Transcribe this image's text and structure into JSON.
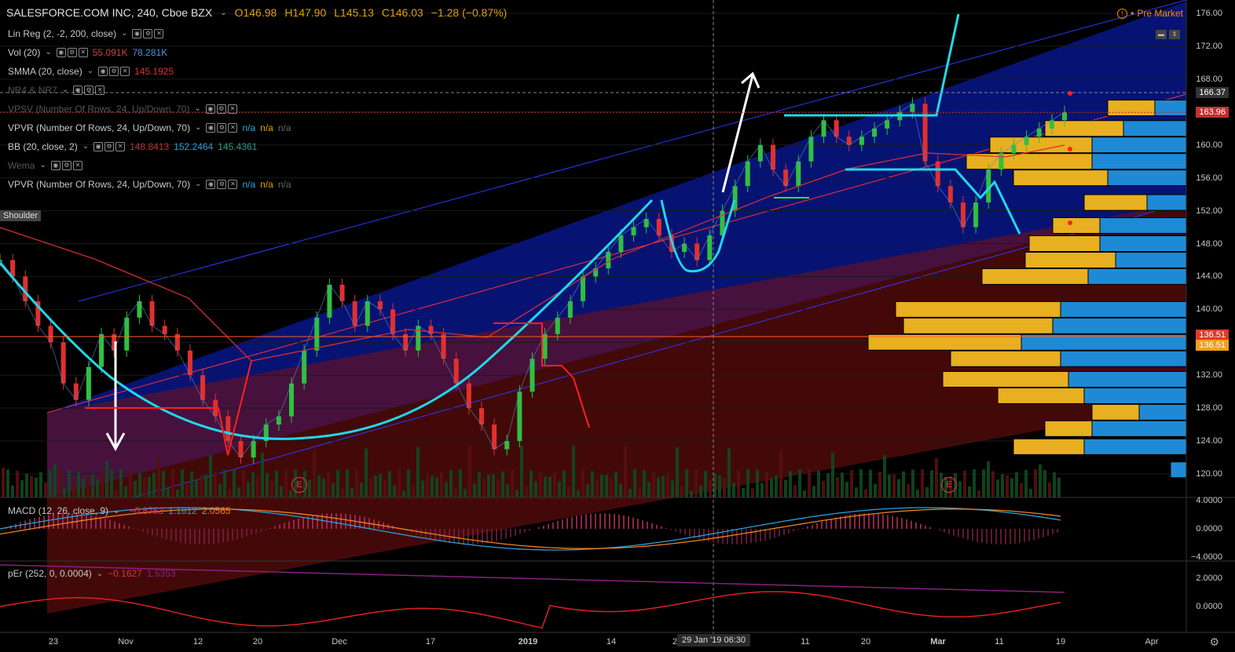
{
  "header": {
    "symbol": "SALESFORCE.COM INC, 240, Cboe BZX",
    "open": "O146.98",
    "high": "H147.90",
    "low": "L145.13",
    "close": "C146.03",
    "change": "−1.28 (−0.87%)",
    "pre_market": "Pre Market"
  },
  "indicators": [
    {
      "name": "Lin Reg (2, -2, 200, close)",
      "values": []
    },
    {
      "name": "Vol (20)",
      "values": [
        {
          "text": "55.091K",
          "color": "#d04040"
        },
        {
          "text": "78.281K",
          "color": "#4a90e2"
        }
      ]
    },
    {
      "name": "SMMA (20, close)",
      "values": [
        {
          "text": "145.1925",
          "color": "#e03030"
        }
      ]
    },
    {
      "name": "NR4 & NR7",
      "values": [],
      "dim": true
    },
    {
      "name": "VPSV (Number Of Rows, 24, Up/Down, 70)",
      "values": [],
      "dim": true
    },
    {
      "name": "VPVR (Number Of Rows, 24, Up/Down, 70)",
      "values": [
        {
          "text": "n/a",
          "color": "#29a8e0"
        },
        {
          "text": "n/a",
          "color": "#e0a000"
        },
        {
          "text": "n/a",
          "color": "#666"
        }
      ]
    },
    {
      "name": "BB (20, close, 2)",
      "values": [
        {
          "text": "148.8413",
          "color": "#c03030"
        },
        {
          "text": "152.2464",
          "color": "#2a9fd6"
        },
        {
          "text": "145.4361",
          "color": "#2a9f8a"
        }
      ]
    },
    {
      "name": "Wema",
      "values": [],
      "dim": true
    },
    {
      "name": "VPVR (Number Of Rows, 24, Up/Down, 70)",
      "values": [
        {
          "text": "n/a",
          "color": "#29a8e0"
        },
        {
          "text": "n/a",
          "color": "#e0a000"
        },
        {
          "text": "n/a",
          "color": "#666"
        }
      ]
    }
  ],
  "macd_legend": {
    "name": "MACD (12, 26, close, 9)",
    "v1": "−0.8753",
    "v2": "1.1812",
    "v3": "2.0565"
  },
  "per_legend": {
    "name": "pEr (252, 0, 0.0004)",
    "v1": "−0.1627",
    "v2": "1.5353"
  },
  "annotations": {
    "shoulder": "Shoulder",
    "earnings": "E"
  },
  "crosshair_date": "29 Jan '19   06:30",
  "price_tags": [
    {
      "text": "166.37",
      "bg": "#333",
      "price": 166.37
    },
    {
      "text": "163.96",
      "bg": "#c03030",
      "price": 163.96
    },
    {
      "text": "136.51",
      "bg": "#e03a2a",
      "price": 136.9
    },
    {
      "text": "136.51",
      "bg": "#f0a020",
      "price": 135.6
    }
  ],
  "chart_data": {
    "type": "line",
    "title": "SALESFORCE.COM INC, 240, Cboe BZX",
    "y_ticks": [
      176,
      172,
      168,
      164,
      160,
      156,
      152,
      148,
      144,
      140,
      136,
      132,
      128,
      124,
      120
    ],
    "y_tick_labels": [
      "176.00",
      "172.00",
      "168.00",
      "164.00",
      "160.00",
      "156.00",
      "152.00",
      "148.00",
      "144.00",
      "140.00",
      "136.00",
      "132.00",
      "128.00",
      "124.00",
      "120.00"
    ],
    "x_tick_labels": [
      "23",
      "Nov",
      "12",
      "20",
      "Dec",
      "17",
      "2019",
      "14",
      "21",
      "11",
      "20",
      "Mar",
      "11",
      "19",
      "Apr"
    ],
    "x_tick_bold": [
      "2019",
      "Mar"
    ],
    "ylim": [
      120,
      177
    ],
    "close_series": [
      146,
      144,
      141,
      138,
      136,
      131,
      129,
      133,
      137,
      135,
      139,
      141,
      138,
      137,
      135,
      132,
      129,
      127,
      124,
      122,
      124,
      126,
      127,
      131,
      135,
      139,
      143,
      141,
      138,
      141,
      140,
      137,
      135,
      138,
      137,
      134,
      131,
      128,
      126,
      123,
      124,
      130,
      134,
      137,
      139,
      141,
      144,
      145,
      147,
      149,
      150,
      151,
      149,
      147,
      148,
      146,
      149,
      152,
      155,
      158,
      160,
      157,
      155,
      158,
      161,
      163,
      161,
      160,
      161,
      162,
      163,
      164,
      165,
      158,
      155,
      153,
      150,
      153,
      157,
      159,
      160,
      161,
      162,
      163,
      164
    ],
    "macd_ticks": [
      {
        "text": "4.0000",
        "v": 4
      },
      {
        "text": "0.0000",
        "v": 0
      },
      {
        "text": "−4.0000",
        "v": -4
      }
    ],
    "per_ticks": [
      {
        "text": "2.0000",
        "v": 2
      },
      {
        "text": "0.0000",
        "v": 0
      }
    ]
  }
}
